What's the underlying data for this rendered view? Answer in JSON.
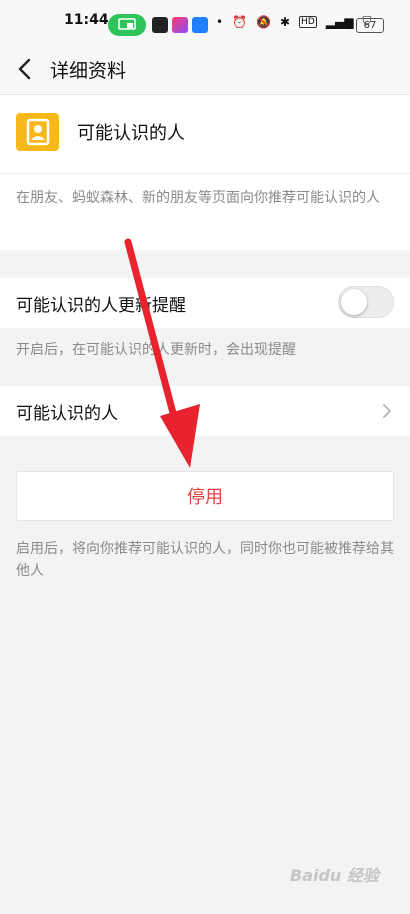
{
  "status_bar": {
    "time": "11:44",
    "battery": "67",
    "icons": [
      "cast-icon",
      "app-icon",
      "app-icon",
      "app-icon",
      "alarm-icon",
      "mute-icon",
      "bluetooth-icon",
      "hd-icon",
      "signal-icon",
      "vpn-icon",
      "battery-icon"
    ]
  },
  "nav": {
    "title": "详细资料"
  },
  "profile": {
    "title": "可能认识的人",
    "description": "在朋友、蚂蚁森林、新的朋友等页面向你推荐可能认识的人"
  },
  "update_reminder": {
    "label": "可能认识的人更新提醒",
    "enabled": false,
    "hint": "开启后，在可能认识的人更新时，会出现提醒"
  },
  "link": {
    "label": "可能认识的人"
  },
  "disable": {
    "label": "停用",
    "hint": "启用后，将向你推荐可能认识的人，同时你也可能被推荐给其他人"
  },
  "watermark": "Baidu 经验",
  "colors": {
    "accent_yellow": "#f6b81a",
    "danger_red": "#e64340",
    "cast_green": "#2fc45a",
    "annotation_red": "#e8232e"
  }
}
